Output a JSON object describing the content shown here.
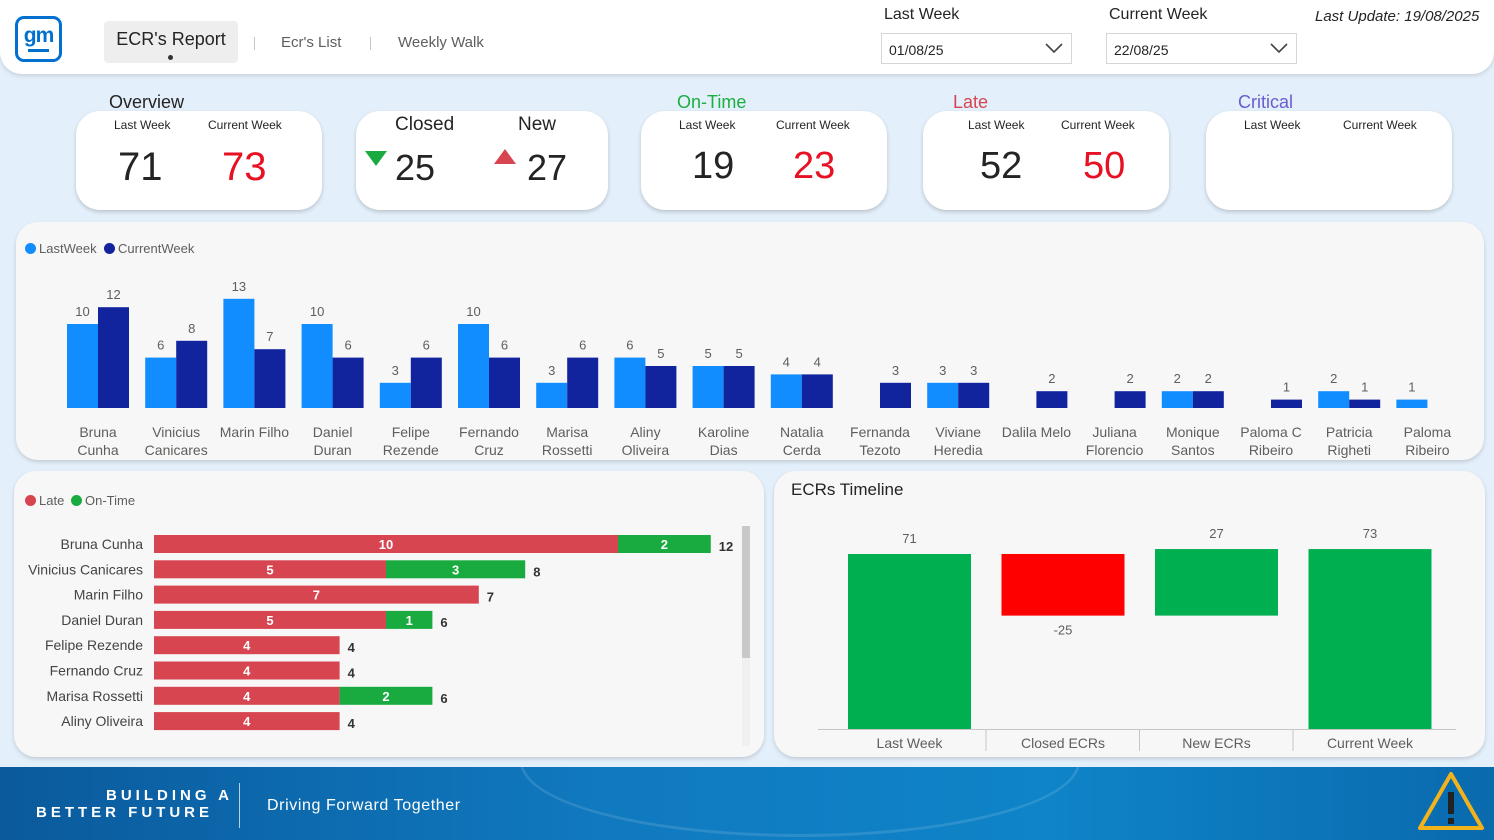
{
  "header": {
    "logo_text": "gm",
    "tabs": [
      {
        "label": "ECR's Report",
        "active": true
      },
      {
        "label": "Ecr's List",
        "active": false
      },
      {
        "label": "Weekly Walk",
        "active": false
      }
    ],
    "filters": {
      "last_week_label": "Last Week",
      "last_week_value": "01/08/25",
      "current_week_label": "Current Week",
      "current_week_value": "22/08/25"
    },
    "last_update": "Last Update: 19/08/2025"
  },
  "kpis": {
    "overview": {
      "title": "Overview",
      "last_label": "Last Week",
      "current_label": "Current Week",
      "last": "71",
      "current": "73"
    },
    "closed_new": {
      "closed_label": "Closed",
      "closed": "25",
      "new_label": "New",
      "new": "27"
    },
    "ontime": {
      "title": "On-Time",
      "title_color": "#1aaf3f",
      "last_label": "Last Week",
      "current_label": "Current Week",
      "last": "19",
      "current": "23"
    },
    "late": {
      "title": "Late",
      "title_color": "#d64550",
      "last_label": "Last Week",
      "current_label": "Current Week",
      "last": "52",
      "current": "50"
    },
    "critical": {
      "title": "Critical",
      "title_color": "#6b5bd0",
      "last_label": "Last Week",
      "current_label": "Current Week"
    }
  },
  "colors": {
    "last_week": "#118dff",
    "current_week": "#12239e",
    "late": "#d64550",
    "ontime": "#1aab40",
    "timeline_up": "#00b050",
    "timeline_down": "#ff0000"
  },
  "chart_data": [
    {
      "type": "bar",
      "legend": [
        "LastWeek",
        "CurrentWeek"
      ],
      "categories": [
        "Bruna Cunha",
        "Vinicius Canicares",
        "Marin Filho",
        "Daniel Duran",
        "Felipe Rezende",
        "Fernando Cruz",
        "Marisa Rossetti",
        "Aliny Oliveira",
        "Karoline Dias",
        "Natalia Cerda",
        "Fernanda Tezoto",
        "Viviane Heredia",
        "Dalila Melo",
        "Juliana Florencio",
        "Monique Santos",
        "Paloma C Ribeiro",
        "Patricia Righeti",
        "Paloma Ribeiro"
      ],
      "category_lines": [
        [
          "Bruna",
          "Cunha"
        ],
        [
          "Vinicius",
          "Canicares"
        ],
        [
          "Marin Filho"
        ],
        [
          "Daniel",
          "Duran"
        ],
        [
          "Felipe",
          "Rezende"
        ],
        [
          "Fernando",
          "Cruz"
        ],
        [
          "Marisa",
          "Rossetti"
        ],
        [
          "Aliny",
          "Oliveira"
        ],
        [
          "Karoline",
          "Dias"
        ],
        [
          "Natalia",
          "Cerda"
        ],
        [
          "Fernanda",
          "Tezoto"
        ],
        [
          "Viviane",
          "Heredia"
        ],
        [
          "Dalila Melo"
        ],
        [
          "Juliana",
          "Florencio"
        ],
        [
          "Monique",
          "Santos"
        ],
        [
          "Paloma C",
          "Ribeiro"
        ],
        [
          "Patricia",
          "Righeti"
        ],
        [
          "Paloma",
          "Ribeiro"
        ]
      ],
      "series": [
        {
          "name": "LastWeek",
          "values": [
            10,
            6,
            13,
            10,
            3,
            10,
            3,
            6,
            5,
            4,
            null,
            3,
            null,
            null,
            2,
            null,
            2,
            1
          ]
        },
        {
          "name": "CurrentWeek",
          "values": [
            12,
            8,
            7,
            6,
            6,
            6,
            6,
            5,
            5,
            4,
            3,
            3,
            2,
            2,
            2,
            1,
            1,
            null
          ]
        }
      ],
      "ylim": [
        0,
        13
      ]
    },
    {
      "type": "bar",
      "orientation": "horizontal",
      "stacked": true,
      "legend": [
        "Late",
        "On-Time"
      ],
      "categories": [
        "Bruna Cunha",
        "Vinicius Canicares",
        "Marin Filho",
        "Daniel Duran",
        "Felipe Rezende",
        "Fernando Cruz",
        "Marisa Rossetti",
        "Aliny Oliveira"
      ],
      "series": [
        {
          "name": "Late",
          "values": [
            10,
            5,
            7,
            5,
            4,
            4,
            4,
            4
          ]
        },
        {
          "name": "On-Time",
          "values": [
            2,
            3,
            null,
            1,
            null,
            null,
            2,
            null
          ]
        }
      ],
      "totals": [
        12,
        8,
        7,
        6,
        4,
        4,
        6,
        4
      ]
    },
    {
      "type": "bar",
      "subtype": "waterfall",
      "title": "ECRs Timeline",
      "categories": [
        "Last Week",
        "Closed ECRs",
        "New ECRs",
        "Current Week"
      ],
      "values": [
        71,
        -25,
        27,
        73
      ],
      "labels": [
        "71",
        "-25",
        "27",
        "73"
      ]
    }
  ],
  "footer": {
    "tagline_line1": "BUILDING A",
    "tagline_line2": "BETTER FUTURE",
    "slogan": "Driving Forward Together"
  }
}
